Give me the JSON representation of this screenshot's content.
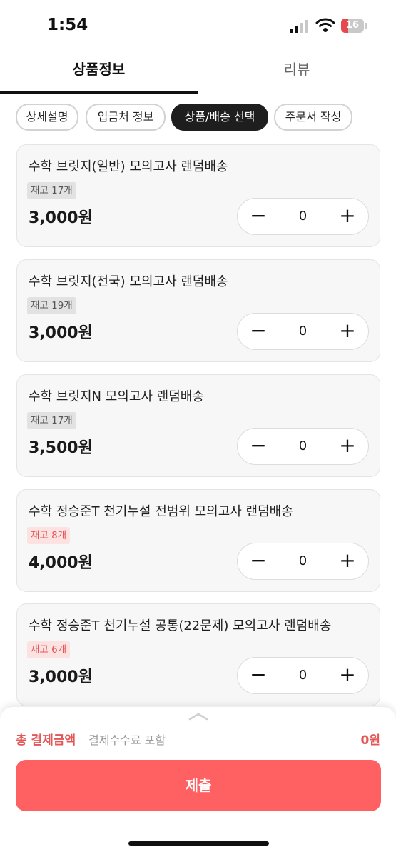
{
  "status_bar": {
    "time": "1:54",
    "battery": "16",
    "battery_color": "#e5484d"
  },
  "tabs": [
    {
      "label": "상품정보",
      "active": true
    },
    {
      "label": "리뷰",
      "active": false
    }
  ],
  "chips": [
    {
      "label": "상세설명"
    },
    {
      "label": "입금처 정보"
    },
    {
      "label": "상품/배송 선택",
      "active": true
    },
    {
      "label": "주문서 작성"
    }
  ],
  "products": [
    {
      "title": "수학 브릿지(일반) 모의고사 랜덤배송",
      "stock": "재고 17개",
      "stock_level": "normal",
      "price": "3,000원",
      "qty": "0"
    },
    {
      "title": "수학 브릿지(전국) 모의고사 랜덤배송",
      "stock": "재고 19개",
      "stock_level": "normal",
      "price": "3,000원",
      "qty": "0"
    },
    {
      "title": "수학 브릿지N 모의고사 랜덤배송",
      "stock": "재고 17개",
      "stock_level": "normal",
      "price": "3,500원",
      "qty": "0"
    },
    {
      "title": "수학 정승준T 천기누설 전범위 모의고사 랜덤배송",
      "stock": "재고 8개",
      "stock_level": "low",
      "price": "4,000원",
      "qty": "0"
    },
    {
      "title": "수학 정승준T 천기누설 공통(22문제) 모의고사 랜덤배송",
      "stock": "재고 6개",
      "stock_level": "low",
      "price": "3,000원",
      "qty": "0"
    }
  ],
  "stepper_icons": {
    "decrease": "minus-icon",
    "increase": "plus-icon"
  },
  "summary": {
    "total_label": "총 결제금액",
    "total_sub": "결제수수료 포함",
    "total_amount": "0원",
    "submit_label": "제출"
  },
  "colors": {
    "accent": "#ff6163",
    "warning_text": "#e45757",
    "dark_chip": "#1e1e1e"
  }
}
